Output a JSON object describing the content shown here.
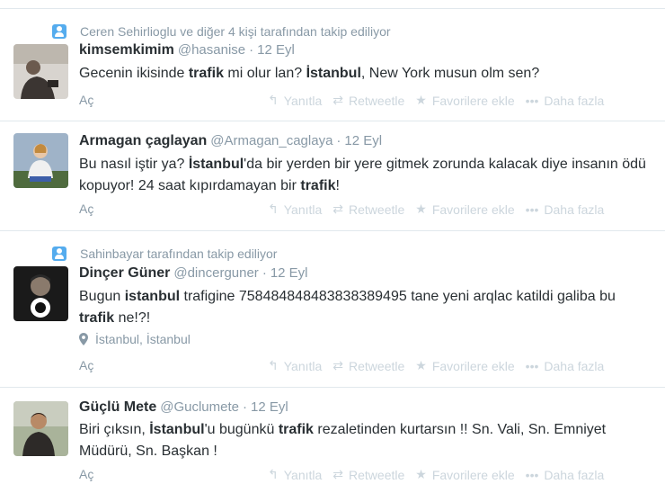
{
  "tweets": [
    {
      "context": "Ceren Sehirlioglu ve diğer 4 kişi tarafından takip ediliyor",
      "fullname": "kimsemkimim",
      "username": "@hasanise",
      "time": "12 Eyl",
      "text_segments": [
        {
          "t": "Gecenin ikisinde ",
          "b": false
        },
        {
          "t": "trafik",
          "b": true
        },
        {
          "t": " mi olur lan? ",
          "b": false
        },
        {
          "t": "İstanbul",
          "b": true
        },
        {
          "t": ", New York musun olm sen?",
          "b": false
        }
      ],
      "location": "",
      "expand": "Aç"
    },
    {
      "context": "",
      "fullname": "Armagan çaglayan",
      "username": "@Armagan_caglaya",
      "time": "12 Eyl",
      "text_segments": [
        {
          "t": "Bu nasıl iştir ya? ",
          "b": false
        },
        {
          "t": "İstanbul",
          "b": true
        },
        {
          "t": "'da bir yerden bir yere gitmek zorunda kalacak diye insanın ödü kopuyor! 24 saat kıpırdamayan bir ",
          "b": false
        },
        {
          "t": "trafik",
          "b": true
        },
        {
          "t": "!",
          "b": false
        }
      ],
      "location": "",
      "expand": "Aç"
    },
    {
      "context": "Sahinbayar tarafından takip ediliyor",
      "fullname": "Dinçer Güner",
      "username": "@dincerguner",
      "time": "12 Eyl",
      "text_segments": [
        {
          "t": "Bugun ",
          "b": false
        },
        {
          "t": "istanbul",
          "b": true
        },
        {
          "t": " trafigine 758484848483838389495 tane yeni arqlac katildi galiba bu ",
          "b": false
        },
        {
          "t": "trafik",
          "b": true
        },
        {
          "t": " ne!?!",
          "b": false
        }
      ],
      "location": "İstanbul, İstanbul",
      "expand": "Aç"
    },
    {
      "context": "",
      "fullname": "Güçlü Mete",
      "username": "@Guclumete",
      "time": "12 Eyl",
      "text_segments": [
        {
          "t": "Biri çıksın, ",
          "b": false
        },
        {
          "t": "İstanbul",
          "b": true
        },
        {
          "t": "'u bugünkü ",
          "b": false
        },
        {
          "t": "trafik",
          "b": true
        },
        {
          "t": " rezaletinden kurtarsın !! Sn. Vali, Sn. Emniyet Müdürü, Sn. Başkan !",
          "b": false
        }
      ],
      "location": "",
      "expand": "Aç"
    }
  ],
  "actions": {
    "reply": "Yanıtla",
    "retweet": "Retweetle",
    "favorite": "Favorilere ekle",
    "more": "Daha fazla"
  },
  "icons": {
    "context": "person-icon",
    "reply": "reply-icon",
    "retweet": "retweet-icon",
    "favorite": "star-icon",
    "more": "more-dots-icon",
    "location": "map-pin-icon"
  },
  "colors": {
    "accent": "#55acee",
    "muted": "#8899a6",
    "action": "#ccd6dd",
    "text": "#292f33",
    "divider": "#e1e8ed"
  }
}
